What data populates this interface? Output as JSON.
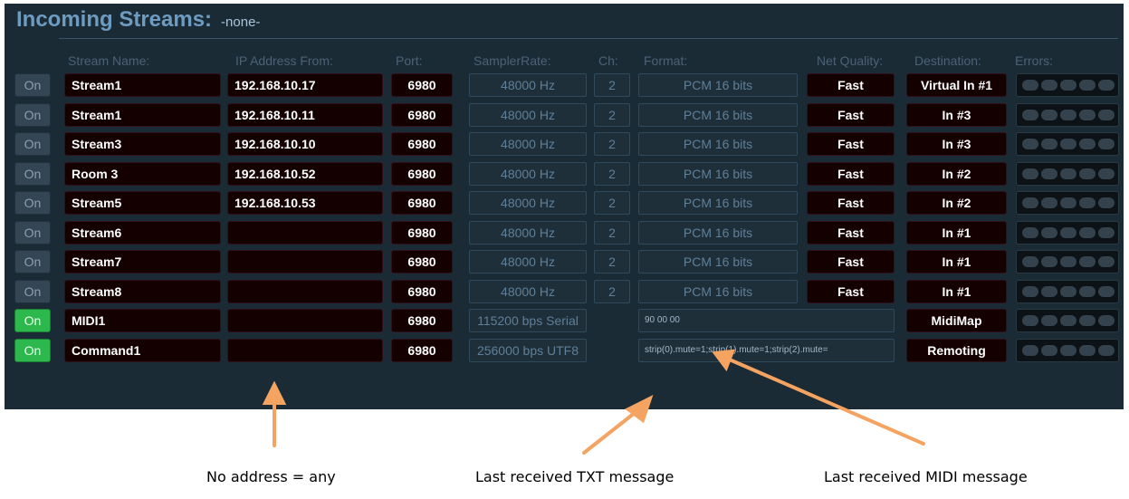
{
  "header": {
    "title": "Incoming Streams:",
    "subtitle": "-none-"
  },
  "columns": {
    "stream_name": "Stream Name:",
    "ip_address": "IP Address From:",
    "port": "Port:",
    "samplerate": "SamplerRate:",
    "ch": "Ch:",
    "format": "Format:",
    "net_quality": "Net Quality:",
    "destination": "Destination:",
    "errors": "Errors:"
  },
  "rows": [
    {
      "on": "On",
      "active": false,
      "name": "Stream1",
      "ip": "192.168.10.17",
      "port": "6980",
      "rate": "48000 Hz",
      "ch": "2",
      "format": "PCM 16 bits",
      "quality": "Fast",
      "dest": "Virtual In #1"
    },
    {
      "on": "On",
      "active": false,
      "name": "Stream1",
      "ip": "192.168.10.11",
      "port": "6980",
      "rate": "48000 Hz",
      "ch": "2",
      "format": "PCM 16 bits",
      "quality": "Fast",
      "dest": "In #3"
    },
    {
      "on": "On",
      "active": false,
      "name": "Stream3",
      "ip": "192.168.10.10",
      "port": "6980",
      "rate": "48000 Hz",
      "ch": "2",
      "format": "PCM 16 bits",
      "quality": "Fast",
      "dest": "In #3"
    },
    {
      "on": "On",
      "active": false,
      "name": "Room 3",
      "ip": "192.168.10.52",
      "port": "6980",
      "rate": "48000 Hz",
      "ch": "2",
      "format": "PCM 16 bits",
      "quality": "Fast",
      "dest": "In #2"
    },
    {
      "on": "On",
      "active": false,
      "name": "Stream5",
      "ip": "192.168.10.53",
      "port": "6980",
      "rate": "48000 Hz",
      "ch": "2",
      "format": "PCM 16 bits",
      "quality": "Fast",
      "dest": "In #2"
    },
    {
      "on": "On",
      "active": false,
      "name": "Stream6",
      "ip": "",
      "port": "6980",
      "rate": "48000 Hz",
      "ch": "2",
      "format": "PCM 16 bits",
      "quality": "Fast",
      "dest": "In #1"
    },
    {
      "on": "On",
      "active": false,
      "name": "Stream7",
      "ip": "",
      "port": "6980",
      "rate": "48000 Hz",
      "ch": "2",
      "format": "PCM 16 bits",
      "quality": "Fast",
      "dest": "In #1"
    },
    {
      "on": "On",
      "active": false,
      "name": "Stream8",
      "ip": "",
      "port": "6980",
      "rate": "48000 Hz",
      "ch": "2",
      "format": "PCM 16 bits",
      "quality": "Fast",
      "dest": "In #1"
    },
    {
      "on": "On",
      "active": true,
      "name": "MIDI1",
      "ip": "",
      "port": "6980",
      "rate": "115200 bps Serial",
      "message": "90 00 00",
      "dest": "MidiMap"
    },
    {
      "on": "On",
      "active": true,
      "name": "Command1",
      "ip": "",
      "port": "6980",
      "rate": "256000 bps UTF8",
      "message": "strip(0).mute=1;strip(1).mute=1;strip(2).mute=",
      "dest": "Remoting"
    }
  ],
  "annotations": {
    "no_address": "No address = any",
    "last_txt": "Last received TXT message",
    "last_midi": "Last received MIDI message"
  },
  "colors": {
    "panel_bg": "#1b2b36",
    "on_active": "#2db84d",
    "arrow": "#f4a460",
    "title": "#6e9cc0"
  }
}
